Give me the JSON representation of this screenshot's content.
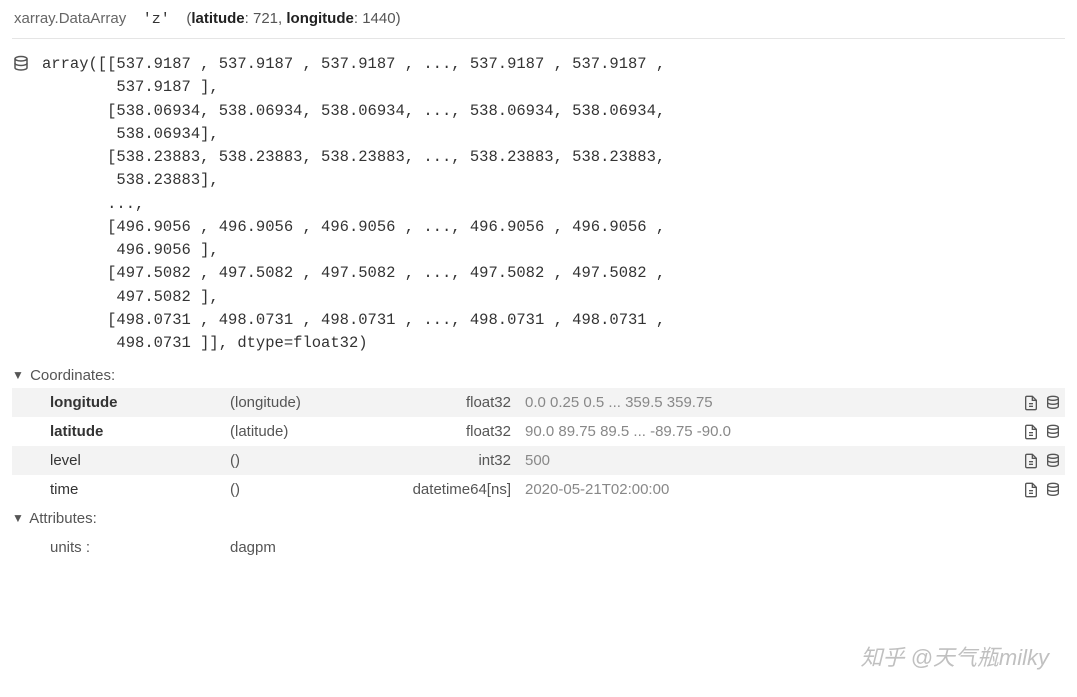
{
  "header": {
    "obj_type": "xarray.DataArray",
    "var_name": "'z'",
    "dims_text": "(latitude: 721, longitude: 1440)"
  },
  "array_repr": "array([[537.9187 , 537.9187 , 537.9187 , ..., 537.9187 , 537.9187 ,\n        537.9187 ],\n       [538.06934, 538.06934, 538.06934, ..., 538.06934, 538.06934,\n        538.06934],\n       [538.23883, 538.23883, 538.23883, ..., 538.23883, 538.23883,\n        538.23883],\n       ...,\n       [496.9056 , 496.9056 , 496.9056 , ..., 496.9056 , 496.9056 ,\n        496.9056 ],\n       [497.5082 , 497.5082 , 497.5082 , ..., 497.5082 , 497.5082 ,\n        497.5082 ],\n       [498.0731 , 498.0731 , 498.0731 , ..., 498.0731 , 498.0731 ,\n        498.0731 ]], dtype=float32)",
  "sections": {
    "coordinates_label": "Coordinates:",
    "attributes_label": "Attributes:"
  },
  "coords": [
    {
      "name": "longitude",
      "bold": true,
      "alt": true,
      "dims": "(longitude)",
      "dtype": "float32",
      "preview": "0.0 0.25 0.5 ... 359.5 359.75"
    },
    {
      "name": "latitude",
      "bold": true,
      "alt": false,
      "dims": "(latitude)",
      "dtype": "float32",
      "preview": "90.0 89.75 89.5 ... -89.75 -90.0"
    },
    {
      "name": "level",
      "bold": false,
      "alt": true,
      "dims": "()",
      "dtype": "int32",
      "preview": "500"
    },
    {
      "name": "time",
      "bold": false,
      "alt": false,
      "dims": "()",
      "dtype": "datetime64[ns]",
      "preview": "2020-05-21T02:00:00"
    }
  ],
  "attrs": [
    {
      "key": "units :",
      "value": "dagpm"
    }
  ],
  "watermark": "知乎 @天气瓶milky"
}
